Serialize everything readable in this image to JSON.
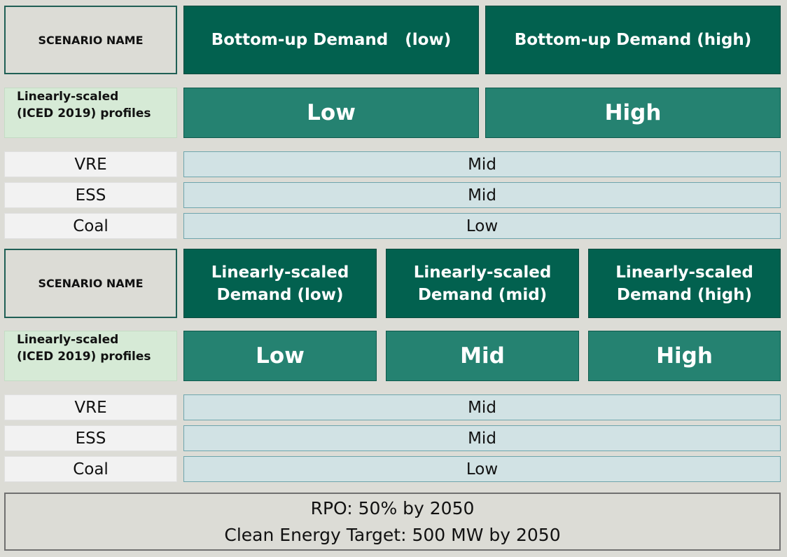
{
  "top": {
    "scenario_label": "SCENARIO NAME",
    "scenarios": [
      "Bottom-up Demand   (low)",
      "Bottom-up Demand (high)"
    ],
    "profile_label": [
      "Linearly-scaled",
      "(ICED 2019) profiles"
    ],
    "profile_levels": [
      "Low",
      "High"
    ],
    "rows": [
      {
        "label": "VRE",
        "value": "Mid"
      },
      {
        "label": "ESS",
        "value": "Mid"
      },
      {
        "label": "Coal",
        "value": "Low"
      }
    ]
  },
  "bottom": {
    "scenario_label": "SCENARIO NAME",
    "scenarios": [
      [
        "Linearly-scaled",
        "Demand (low)"
      ],
      [
        "Linearly-scaled",
        "Demand (mid)"
      ],
      [
        "Linearly-scaled",
        "Demand (high)"
      ]
    ],
    "profile_label": [
      "Linearly-scaled",
      "(ICED 2019) profiles"
    ],
    "profile_levels": [
      "Low",
      "Mid",
      "High"
    ],
    "rows": [
      {
        "label": "VRE",
        "value": "Mid"
      },
      {
        "label": "ESS",
        "value": "Mid"
      },
      {
        "label": "Coal",
        "value": "Low"
      }
    ]
  },
  "footer": {
    "line1": "RPO: 50% by 2050",
    "line2": "Clean Energy Target: 500 MW by 2050"
  }
}
